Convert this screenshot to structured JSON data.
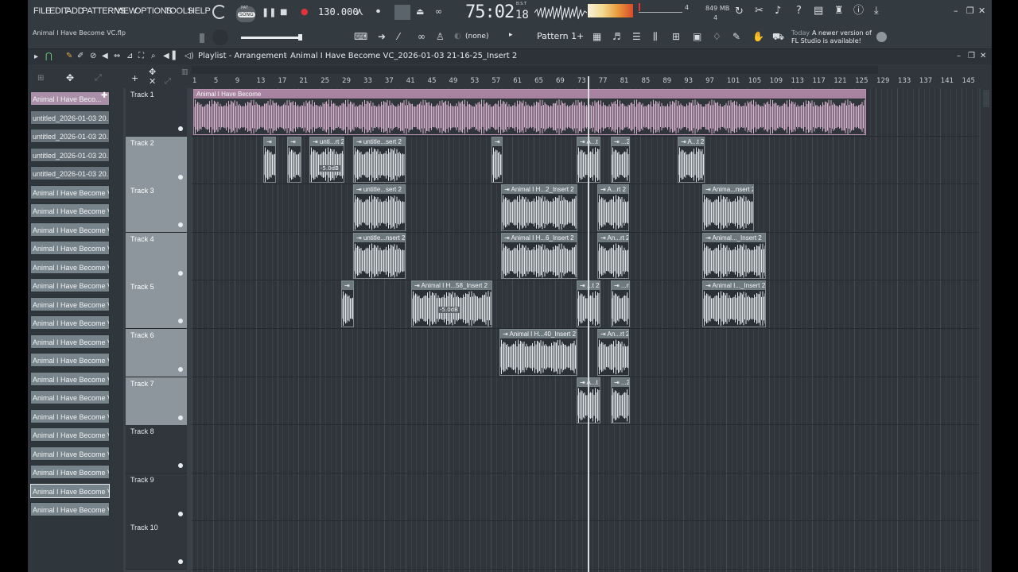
{
  "menu": [
    "FILE",
    "EDIT",
    "ADD",
    "PATTERNS",
    "VIEW",
    "OPTIONS",
    "TOOLS",
    "HELP"
  ],
  "transport": {
    "song_label": "SONG",
    "pat_label": "PAT",
    "bpm": "130.000",
    "time": "75:02",
    "time_sub": "18",
    "time_unit": "B:S:T",
    "memory": "849 MB",
    "cpu_top": "4",
    "cpu_bottom": "4"
  },
  "project_file": "Animal I Have Become VC.flp",
  "pattern": {
    "selector": "(none)",
    "name": "Pattern 1"
  },
  "news": {
    "line1_prefix": "Today",
    "line1": "A newer version of",
    "line2": "FL Studio is available!"
  },
  "playlist": {
    "title": "Playlist - Arrangement",
    "breadcrumb_sep": "›",
    "clip_name": "Animal I Have Become VC_2026-01-03 21-16-25_Insert 2"
  },
  "ruler": [
    "1",
    "5",
    "9",
    "13",
    "17",
    "21",
    "25",
    "29",
    "33",
    "37",
    "41",
    "45",
    "49",
    "53",
    "57",
    "61",
    "65",
    "69",
    "73",
    "77",
    "81",
    "85",
    "89",
    "93",
    "97",
    "101",
    "105",
    "109",
    "113",
    "117",
    "121",
    "125",
    "129",
    "133",
    "137",
    "141",
    "145"
  ],
  "picker": [
    "Animal I Have Beco...",
    "untitled_2026-01-03 20...",
    "untitled_2026-01-03 20...",
    "untitled_2026-01-03 20...",
    "untitled_2026-01-03 20...",
    "Animal I Have Become V...",
    "Animal I Have Become V...",
    "Animal I Have Become V...",
    "Animal I Have Become V...",
    "Animal I Have Become V...",
    "Animal I Have Become V...",
    "Animal I Have Become V...",
    "Animal I Have Become V...",
    "Animal I Have Become V...",
    "Animal I Have Become V...",
    "Animal I Have Become V...",
    "Animal I Have Become V...",
    "Animal I Have Become V...",
    "Animal I Have Become V...",
    "Animal I Have Become V...",
    "Animal I Have Become V...",
    "Animal I Have Become V...",
    "Animal I Have Become V..."
  ],
  "tracks": [
    "Track 1",
    "Track 2",
    "Track 3",
    "Track 4",
    "Track 5",
    "Track 6",
    "Track 7",
    "Track 8",
    "Track 9",
    "Track 10"
  ],
  "clips": {
    "main": "Animal I Have Become",
    "t2": [
      "",
      "",
      "unti...rt 2",
      "untitle...sert 2",
      "",
      "A...t 2",
      "...2",
      "A...t 2"
    ],
    "t3": [
      "untitle...sert 2",
      "Animal I H...2_Insert 2",
      "A...rt 2",
      "Anima...nsert 2"
    ],
    "t4": [
      "untitle...nsert 2",
      "Animal I H...6_Insert 2",
      "An...rt 2",
      "Animal..._Insert 2"
    ],
    "t5": [
      "",
      "Animal I H...58_Insert 2",
      "...t 2",
      "...rt 2",
      "Animal I..._Insert 2"
    ],
    "t6": [
      "Animal I H...40_Insert 2",
      "An...rt 2"
    ],
    "t7": [
      "A...t 2",
      "...2"
    ],
    "gain_label": "-5.0dB"
  },
  "colors": {
    "main_clip": "#d8b3d0",
    "audio_clip": "#dde3e6",
    "accent_red": "#e2323a"
  }
}
